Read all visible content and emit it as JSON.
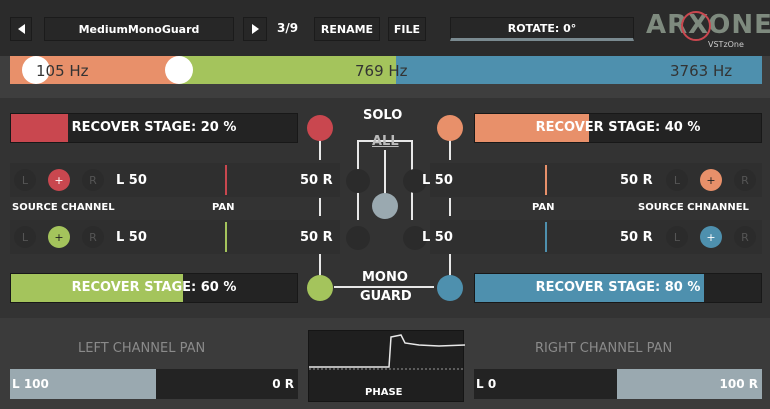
{
  "header": {
    "preset_name": "MediumMonoGuard",
    "preset_counter": "3/9",
    "rename_label": "RENAME",
    "file_label": "FILE",
    "rotate_label": "ROTATE: 0°",
    "logo_text": "ARXONE",
    "logo_sub": "VSTzOne"
  },
  "crossover": {
    "freq_low": "105 Hz",
    "freq_mid": "769 Hz",
    "freq_high": "3763 Hz",
    "colors": {
      "low": "#e8906a",
      "mid": "#a4c45c",
      "high": "#4e90ae"
    }
  },
  "center": {
    "solo_label": "SOLO",
    "all_label": "ALL",
    "mono_label": "MONO",
    "guard_label": "GUARD"
  },
  "bands": {
    "top_left": {
      "recover_label": "RECOVER STAGE: 20 %",
      "recover_fraction": 0.2,
      "color": "#c9474f",
      "pan_left": "L 50",
      "pan_right": "50 R"
    },
    "top_right": {
      "recover_label": "RECOVER STAGE: 40 %",
      "recover_fraction": 0.4,
      "color": "#e8906a",
      "pan_left": "L 50",
      "pan_right": "50 R"
    },
    "bottom_left": {
      "recover_label": "RECOVER STAGE: 60 %",
      "recover_fraction": 0.6,
      "color": "#a4c45c",
      "pan_left": "L 50",
      "pan_right": "50 R"
    },
    "bottom_right": {
      "recover_label": "RECOVER STAGE: 80 %",
      "recover_fraction": 0.8,
      "color": "#4e90ae",
      "pan_left": "L 50",
      "pan_right": "50 R"
    }
  },
  "labels": {
    "source_channel_left": "SOURCE CHANNEL",
    "pan_left": "PAN",
    "pan_right": "PAN",
    "source_channel_right": "SOURCE CHNANNEL",
    "ch_l": "L",
    "ch_plus": "+",
    "ch_r": "R"
  },
  "footer": {
    "left_title": "LEFT CHANNEL PAN",
    "left_value_l": "L 100",
    "left_value_r": "0 R",
    "phase_label": "PHASE",
    "right_title": "RIGHT CHANNEL PAN",
    "right_value_l": "L 0",
    "right_value_r": "100 R"
  }
}
